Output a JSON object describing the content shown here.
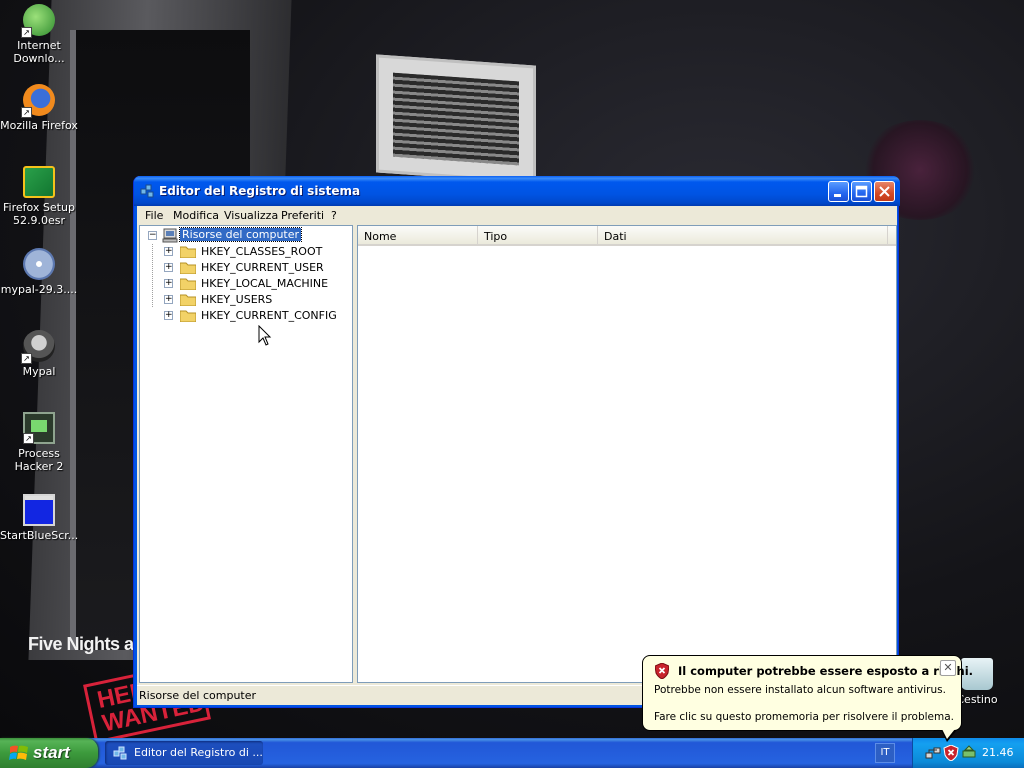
{
  "desktop": {
    "icons": [
      {
        "label": "Internet Downlo...",
        "icon": "internet-download-icon"
      },
      {
        "label": "Mozilla Firefox",
        "icon": "firefox-icon"
      },
      {
        "label": "Firefox Setup 52.9.0esr",
        "icon": "firefox-setup-icon"
      },
      {
        "label": "mypal-29.3....",
        "icon": "cd-installer-icon"
      },
      {
        "label": "Mypal",
        "icon": "mypal-icon"
      },
      {
        "label": "Process Hacker 2",
        "icon": "process-hacker-icon"
      },
      {
        "label": "StartBlueScr...",
        "icon": "bluescreen-icon"
      },
      {
        "label": "Cestino",
        "icon": "recycle-bin-icon"
      }
    ],
    "wallpaper_text": {
      "title": "Five Nights at",
      "poster": "HELP WANTED"
    }
  },
  "window": {
    "title": "Editor del Registro di sistema",
    "menu": [
      "File",
      "Modifica",
      "Visualizza",
      "Preferiti",
      "?"
    ],
    "tree": {
      "root": "Risorse del computer",
      "keys": [
        "HKEY_CLASSES_ROOT",
        "HKEY_CURRENT_USER",
        "HKEY_LOCAL_MACHINE",
        "HKEY_USERS",
        "HKEY_CURRENT_CONFIG"
      ]
    },
    "columns": [
      "Nome",
      "Tipo",
      "Dati"
    ],
    "status": "Risorse del computer"
  },
  "balloon": {
    "title": "Il computer potrebbe essere esposto a rischi.",
    "line1": "Potrebbe non essere installato alcun software antivirus.",
    "line2": "Fare clic su questo promemoria per risolvere il problema."
  },
  "taskbar": {
    "start_label": "start",
    "task_label": "Editor del Registro di ...",
    "language": "IT",
    "clock": "21.46"
  }
}
